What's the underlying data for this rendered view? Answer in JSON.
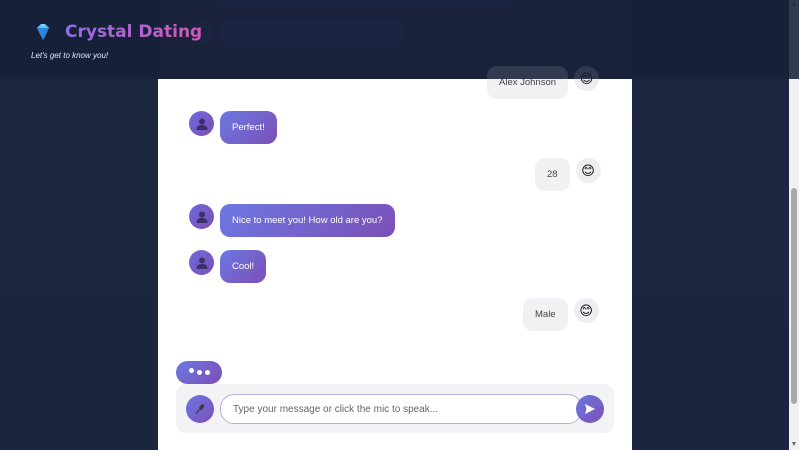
{
  "header": {
    "title": "Crystal Dating",
    "subtitle": "Let's get to know you!",
    "icon": "gem-icon"
  },
  "messages": [
    {
      "sender": "user",
      "text": "Alex Johnson",
      "avatar": "smile-emoji"
    },
    {
      "sender": "bot",
      "text": "Perfect!",
      "avatar": "person-icon"
    },
    {
      "sender": "user",
      "text": "28",
      "avatar": "smile-emoji"
    },
    {
      "sender": "bot",
      "text": "Nice to meet you! How old are you?",
      "avatar": "person-icon"
    },
    {
      "sender": "bot",
      "text": "Cool!",
      "avatar": "person-icon"
    },
    {
      "sender": "user",
      "text": "Male",
      "avatar": "smile-emoji"
    }
  ],
  "input": {
    "placeholder": "Type your message or click the mic to speak...",
    "value": ""
  },
  "colors": {
    "accent_start": "#6d78e2",
    "accent_end": "#7b4fb6",
    "background": "#1c2740",
    "panel": "#ffffff"
  }
}
